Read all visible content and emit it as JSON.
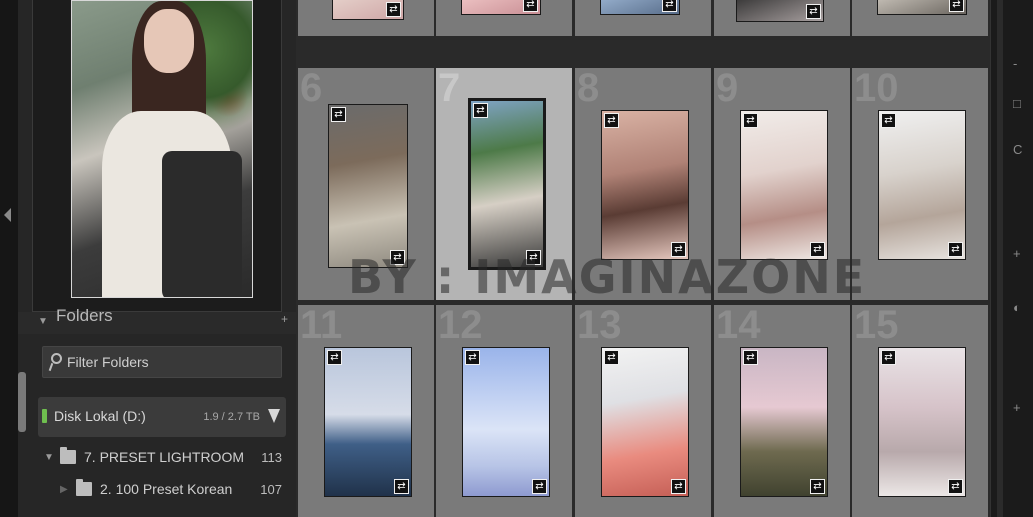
{
  "panels": {
    "folders": {
      "title": "Folders",
      "add_icon": "plus-icon",
      "filter": {
        "placeholder": "Filter Folders",
        "value": ""
      },
      "disk": {
        "name": "Disk Lokal (D:)",
        "size": "1.9 / 2.7 TB",
        "status_color": "#6fbf4f"
      },
      "folders": [
        {
          "name": "7. PRESET LIGHTROOM",
          "count": "113"
        },
        {
          "name": "2. 100 Preset Korean",
          "count": "107"
        }
      ]
    }
  },
  "grid": {
    "cells": [
      {
        "index": "",
        "badge_tl": "",
        "badge_br": "⇄"
      },
      {
        "index": "",
        "badge_tl": "",
        "badge_br": "⇄"
      },
      {
        "index": "",
        "badge_tl": "",
        "badge_br": "⇄"
      },
      {
        "index": "",
        "badge_tl": "",
        "badge_br": "⇄"
      },
      {
        "index": "",
        "badge_tl": "",
        "badge_br": "⇄"
      },
      {
        "index": "6",
        "badge_tl": "⇄",
        "badge_br": "⇄"
      },
      {
        "index": "7",
        "badge_tl": "⇄",
        "badge_br": "⇄"
      },
      {
        "index": "8",
        "badge_tl": "⇄",
        "badge_br": "⇄"
      },
      {
        "index": "9",
        "badge_tl": "⇄",
        "badge_br": "⇄"
      },
      {
        "index": "10",
        "badge_tl": "⇄",
        "badge_br": "⇄"
      },
      {
        "index": "11",
        "badge_tl": "⇄",
        "badge_br": "⇄"
      },
      {
        "index": "12",
        "badge_tl": "⇄",
        "badge_br": "⇄"
      },
      {
        "index": "13",
        "badge_tl": "⇄",
        "badge_br": "⇄"
      },
      {
        "index": "14",
        "badge_tl": "⇄",
        "badge_br": "⇄"
      },
      {
        "index": "15",
        "badge_tl": "⇄",
        "badge_br": "⇄"
      }
    ],
    "selected_index": "7"
  },
  "watermark": "BY : IMAGINAZONE",
  "right_strip": {
    "items": [
      "-",
      "□",
      "C",
      "+",
      "◐",
      "+"
    ]
  }
}
